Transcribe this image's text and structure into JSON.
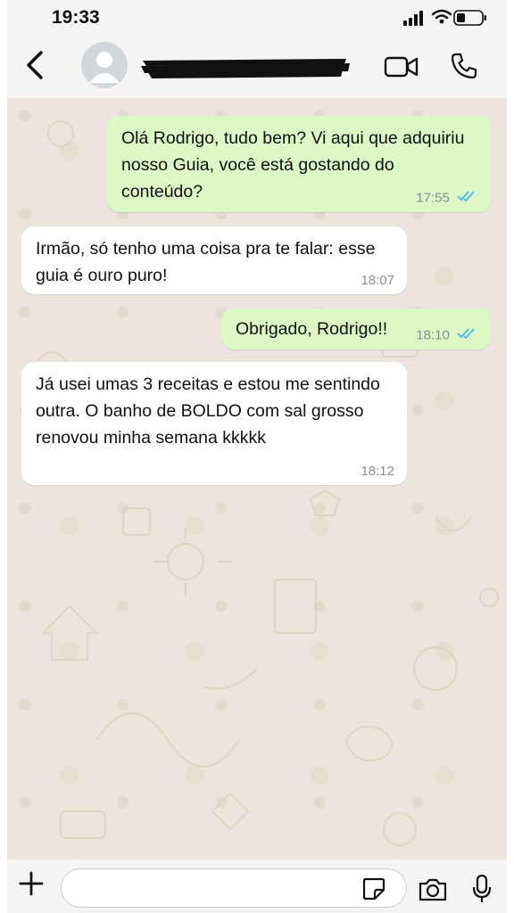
{
  "status_bar": {
    "time": "19:33"
  },
  "header": {
    "contact_name": ""
  },
  "messages": [
    {
      "direction": "outgoing",
      "text": "Olá Rodrigo, tudo bem? Vi aqui que adquiriu nosso Guia, você está gostando do conteúdo?",
      "time": "17:55",
      "status": "read"
    },
    {
      "direction": "incoming",
      "text": "Irmão, só tenho uma coisa pra te falar: esse guia é ouro puro!",
      "time": "18:07"
    },
    {
      "direction": "outgoing",
      "text": "Obrigado, Rodrigo!!",
      "time": "18:10",
      "status": "read"
    },
    {
      "direction": "incoming",
      "text": "Já usei umas 3 receitas e estou me sentindo outra. O banho de BOLDO com sal grosso renovou minha semana kkkkk",
      "time": "18:12"
    }
  ],
  "composer": {
    "value": ""
  },
  "colors": {
    "outgoing_bubble": "#dcf8c6",
    "incoming_bubble": "#ffffff",
    "read_ticks": "#4fb6ec",
    "chat_background": "#ece5dd"
  },
  "icons": [
    "back-chevron-icon",
    "avatar-icon",
    "video-call-icon",
    "phone-call-icon",
    "plus-icon",
    "sticker-icon",
    "camera-icon",
    "microphone-icon",
    "signal-icon",
    "wifi-icon",
    "battery-icon",
    "double-check-icon"
  ]
}
